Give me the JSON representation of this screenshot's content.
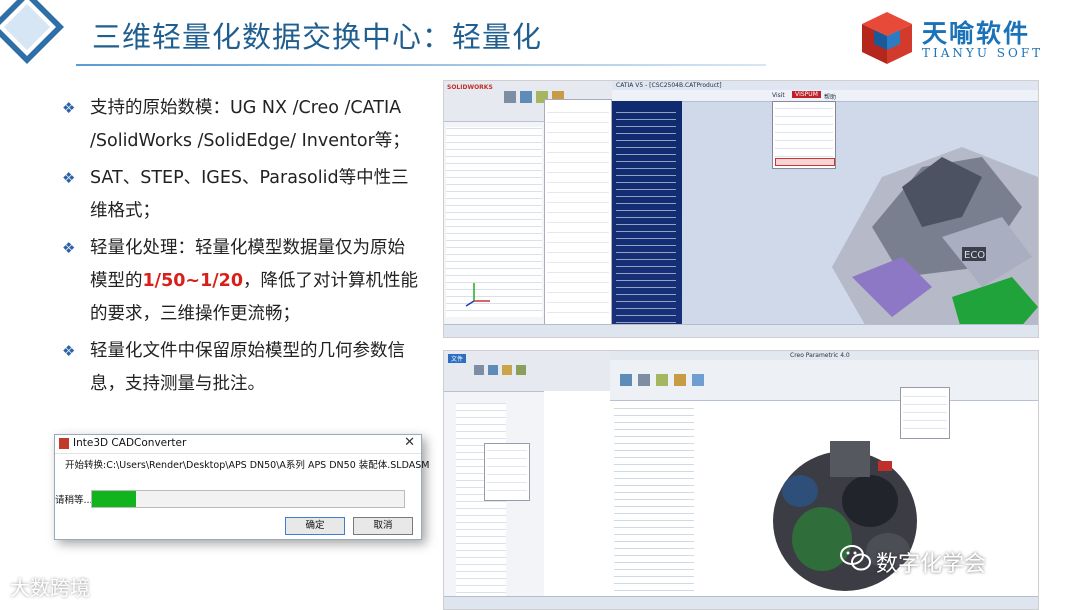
{
  "header": {
    "title": "三维轻量化数据交换中心：轻量化",
    "brand_name": "天喻软件",
    "brand_sub": "TIANYU SOFT"
  },
  "bullets": [
    {
      "text": "支持的原始数模：UG NX /Creo /CATIA /SolidWorks /SolidEdge/ Inventor等；"
    },
    {
      "text": "SAT、STEP、IGES、Parasolid等中性三维格式；"
    },
    {
      "pre": "轻量化处理：轻量化模型数据量仅为原始模型的",
      "highlight": "1/50~1/20",
      "post": "，降低了对计算机性能的要求，三维操作更流畅；"
    },
    {
      "text": "轻量化文件中保留原始模型的几何参数信息，支持测量与批注。"
    }
  ],
  "dialog": {
    "title": "Inte3D CADConverter",
    "close": "✕",
    "message": "开始转换:C:\\Users\\Render\\Desktop\\APS DN50\\A系列 APS DN50 装配体.SLDASM",
    "wait_label": "请稍等...",
    "progress": 0.14,
    "ok_label": "确定",
    "cancel_label": "取消"
  },
  "screenshot_top": {
    "left_app_logo": "SOLIDWORKS",
    "right_title": "CATIA V5 - [CSC2504B.CATProduct]",
    "menu_items": [
      "Visit",
      "VISPUM",
      "帮助"
    ]
  },
  "screenshot_bottom": {
    "left_tab": "文件",
    "right_title": "Creo Parametric 4.0"
  },
  "watermarks": {
    "wechat": "数字化学会",
    "left": "大数跨境"
  },
  "colors": {
    "title": "#1f5e8f",
    "bullet_marker": "#2d63a6",
    "highlight": "#d8201a",
    "progress": "#12b41e",
    "brand": "#1a72b8"
  }
}
